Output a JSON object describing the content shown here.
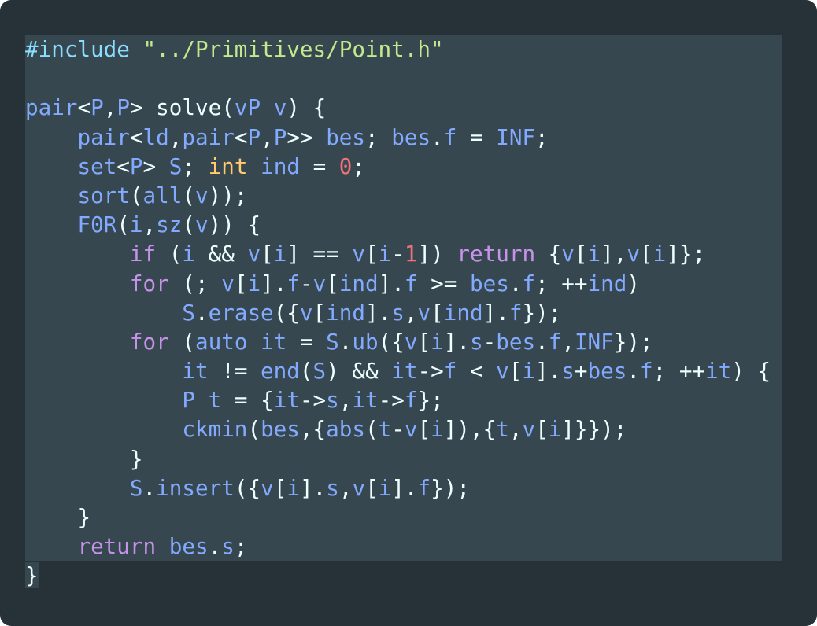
{
  "colors": {
    "background": "#263238",
    "selection": "#37474f",
    "plain": "#eeffff",
    "identifier": "#82aaff",
    "keyword": "#c792ea",
    "type": "#ffcb6b",
    "number": "#f07178",
    "string": "#c3e88d"
  },
  "code": {
    "language": "cpp",
    "lines": [
      [
        [
          "pre",
          "#include "
        ],
        [
          "str",
          "\"../Primitives/Point.h\""
        ]
      ],
      [],
      [
        [
          "id",
          "pair"
        ],
        [
          "plain",
          "<"
        ],
        [
          "id",
          "P"
        ],
        [
          "plain",
          ","
        ],
        [
          "id",
          "P"
        ],
        [
          "plain",
          "> solve("
        ],
        [
          "id",
          "vP"
        ],
        [
          "plain",
          " "
        ],
        [
          "id",
          "v"
        ],
        [
          "plain",
          ") {"
        ]
      ],
      [
        [
          "plain",
          "    "
        ],
        [
          "id",
          "pair"
        ],
        [
          "plain",
          "<"
        ],
        [
          "id",
          "ld"
        ],
        [
          "plain",
          ","
        ],
        [
          "id",
          "pair"
        ],
        [
          "plain",
          "<"
        ],
        [
          "id",
          "P"
        ],
        [
          "plain",
          ","
        ],
        [
          "id",
          "P"
        ],
        [
          "plain",
          ">> "
        ],
        [
          "id",
          "bes"
        ],
        [
          "plain",
          "; "
        ],
        [
          "id",
          "bes"
        ],
        [
          "plain",
          "."
        ],
        [
          "id",
          "f"
        ],
        [
          "plain",
          " = "
        ],
        [
          "id",
          "INF"
        ],
        [
          "plain",
          ";"
        ]
      ],
      [
        [
          "plain",
          "    "
        ],
        [
          "id",
          "set"
        ],
        [
          "plain",
          "<"
        ],
        [
          "id",
          "P"
        ],
        [
          "plain",
          "> "
        ],
        [
          "id",
          "S"
        ],
        [
          "plain",
          "; "
        ],
        [
          "type",
          "int"
        ],
        [
          "plain",
          " "
        ],
        [
          "id",
          "ind"
        ],
        [
          "plain",
          " = "
        ],
        [
          "num",
          "0"
        ],
        [
          "plain",
          ";"
        ]
      ],
      [
        [
          "plain",
          "    "
        ],
        [
          "id",
          "sort"
        ],
        [
          "plain",
          "("
        ],
        [
          "id",
          "all"
        ],
        [
          "plain",
          "("
        ],
        [
          "id",
          "v"
        ],
        [
          "plain",
          "));"
        ]
      ],
      [
        [
          "plain",
          "    "
        ],
        [
          "id",
          "F0R"
        ],
        [
          "plain",
          "("
        ],
        [
          "id",
          "i"
        ],
        [
          "plain",
          ","
        ],
        [
          "id",
          "sz"
        ],
        [
          "plain",
          "("
        ],
        [
          "id",
          "v"
        ],
        [
          "plain",
          ")) {"
        ]
      ],
      [
        [
          "plain",
          "        "
        ],
        [
          "kw",
          "if"
        ],
        [
          "plain",
          " ("
        ],
        [
          "id",
          "i"
        ],
        [
          "plain",
          " && "
        ],
        [
          "id",
          "v"
        ],
        [
          "plain",
          "["
        ],
        [
          "id",
          "i"
        ],
        [
          "plain",
          "] == "
        ],
        [
          "id",
          "v"
        ],
        [
          "plain",
          "["
        ],
        [
          "id",
          "i"
        ],
        [
          "plain",
          "-"
        ],
        [
          "num",
          "1"
        ],
        [
          "plain",
          "]) "
        ],
        [
          "kw",
          "return"
        ],
        [
          "plain",
          " {"
        ],
        [
          "id",
          "v"
        ],
        [
          "plain",
          "["
        ],
        [
          "id",
          "i"
        ],
        [
          "plain",
          "],"
        ],
        [
          "id",
          "v"
        ],
        [
          "plain",
          "["
        ],
        [
          "id",
          "i"
        ],
        [
          "plain",
          "]};"
        ]
      ],
      [
        [
          "plain",
          "        "
        ],
        [
          "kw",
          "for"
        ],
        [
          "plain",
          " (; "
        ],
        [
          "id",
          "v"
        ],
        [
          "plain",
          "["
        ],
        [
          "id",
          "i"
        ],
        [
          "plain",
          "]."
        ],
        [
          "id",
          "f"
        ],
        [
          "plain",
          "-"
        ],
        [
          "id",
          "v"
        ],
        [
          "plain",
          "["
        ],
        [
          "id",
          "ind"
        ],
        [
          "plain",
          "]."
        ],
        [
          "id",
          "f"
        ],
        [
          "plain",
          " >= "
        ],
        [
          "id",
          "bes"
        ],
        [
          "plain",
          "."
        ],
        [
          "id",
          "f"
        ],
        [
          "plain",
          "; ++"
        ],
        [
          "id",
          "ind"
        ],
        [
          "plain",
          ")"
        ]
      ],
      [
        [
          "plain",
          "            "
        ],
        [
          "id",
          "S"
        ],
        [
          "plain",
          "."
        ],
        [
          "id",
          "erase"
        ],
        [
          "plain",
          "({"
        ],
        [
          "id",
          "v"
        ],
        [
          "plain",
          "["
        ],
        [
          "id",
          "ind"
        ],
        [
          "plain",
          "]."
        ],
        [
          "id",
          "s"
        ],
        [
          "plain",
          ","
        ],
        [
          "id",
          "v"
        ],
        [
          "plain",
          "["
        ],
        [
          "id",
          "ind"
        ],
        [
          "plain",
          "]."
        ],
        [
          "id",
          "f"
        ],
        [
          "plain",
          "});"
        ]
      ],
      [
        [
          "plain",
          "        "
        ],
        [
          "kw",
          "for"
        ],
        [
          "plain",
          " ("
        ],
        [
          "id",
          "auto"
        ],
        [
          "plain",
          " "
        ],
        [
          "id",
          "it"
        ],
        [
          "plain",
          " = "
        ],
        [
          "id",
          "S"
        ],
        [
          "plain",
          "."
        ],
        [
          "id",
          "ub"
        ],
        [
          "plain",
          "({"
        ],
        [
          "id",
          "v"
        ],
        [
          "plain",
          "["
        ],
        [
          "id",
          "i"
        ],
        [
          "plain",
          "]."
        ],
        [
          "id",
          "s"
        ],
        [
          "plain",
          "-"
        ],
        [
          "id",
          "bes"
        ],
        [
          "plain",
          "."
        ],
        [
          "id",
          "f"
        ],
        [
          "plain",
          ","
        ],
        [
          "id",
          "INF"
        ],
        [
          "plain",
          "});"
        ]
      ],
      [
        [
          "plain",
          "            "
        ],
        [
          "id",
          "it"
        ],
        [
          "plain",
          " != "
        ],
        [
          "id",
          "end"
        ],
        [
          "plain",
          "("
        ],
        [
          "id",
          "S"
        ],
        [
          "plain",
          ") && "
        ],
        [
          "id",
          "it"
        ],
        [
          "plain",
          "->"
        ],
        [
          "id",
          "f"
        ],
        [
          "plain",
          " < "
        ],
        [
          "id",
          "v"
        ],
        [
          "plain",
          "["
        ],
        [
          "id",
          "i"
        ],
        [
          "plain",
          "]."
        ],
        [
          "id",
          "s"
        ],
        [
          "plain",
          "+"
        ],
        [
          "id",
          "bes"
        ],
        [
          "plain",
          "."
        ],
        [
          "id",
          "f"
        ],
        [
          "plain",
          "; ++"
        ],
        [
          "id",
          "it"
        ],
        [
          "plain",
          ") {"
        ]
      ],
      [
        [
          "plain",
          "            "
        ],
        [
          "id",
          "P"
        ],
        [
          "plain",
          " "
        ],
        [
          "id",
          "t"
        ],
        [
          "plain",
          " = {"
        ],
        [
          "id",
          "it"
        ],
        [
          "plain",
          "->"
        ],
        [
          "id",
          "s"
        ],
        [
          "plain",
          ","
        ],
        [
          "id",
          "it"
        ],
        [
          "plain",
          "->"
        ],
        [
          "id",
          "f"
        ],
        [
          "plain",
          "};"
        ]
      ],
      [
        [
          "plain",
          "            "
        ],
        [
          "id",
          "ckmin"
        ],
        [
          "plain",
          "("
        ],
        [
          "id",
          "bes"
        ],
        [
          "plain",
          ",{"
        ],
        [
          "id",
          "abs"
        ],
        [
          "plain",
          "("
        ],
        [
          "id",
          "t"
        ],
        [
          "plain",
          "-"
        ],
        [
          "id",
          "v"
        ],
        [
          "plain",
          "["
        ],
        [
          "id",
          "i"
        ],
        [
          "plain",
          "]),{"
        ],
        [
          "id",
          "t"
        ],
        [
          "plain",
          ","
        ],
        [
          "id",
          "v"
        ],
        [
          "plain",
          "["
        ],
        [
          "id",
          "i"
        ],
        [
          "plain",
          "]}});"
        ]
      ],
      [
        [
          "plain",
          "        }"
        ]
      ],
      [
        [
          "plain",
          "        "
        ],
        [
          "id",
          "S"
        ],
        [
          "plain",
          "."
        ],
        [
          "id",
          "insert"
        ],
        [
          "plain",
          "({"
        ],
        [
          "id",
          "v"
        ],
        [
          "plain",
          "["
        ],
        [
          "id",
          "i"
        ],
        [
          "plain",
          "]."
        ],
        [
          "id",
          "s"
        ],
        [
          "plain",
          ","
        ],
        [
          "id",
          "v"
        ],
        [
          "plain",
          "["
        ],
        [
          "id",
          "i"
        ],
        [
          "plain",
          "]."
        ],
        [
          "id",
          "f"
        ],
        [
          "plain",
          "});"
        ]
      ],
      [
        [
          "plain",
          "    }"
        ]
      ],
      [
        [
          "plain",
          "    "
        ],
        [
          "kw",
          "return"
        ],
        [
          "plain",
          " "
        ],
        [
          "id",
          "bes"
        ],
        [
          "plain",
          "."
        ],
        [
          "id",
          "s"
        ],
        [
          "plain",
          ";"
        ]
      ],
      [
        [
          "plain",
          "}"
        ]
      ]
    ]
  }
}
